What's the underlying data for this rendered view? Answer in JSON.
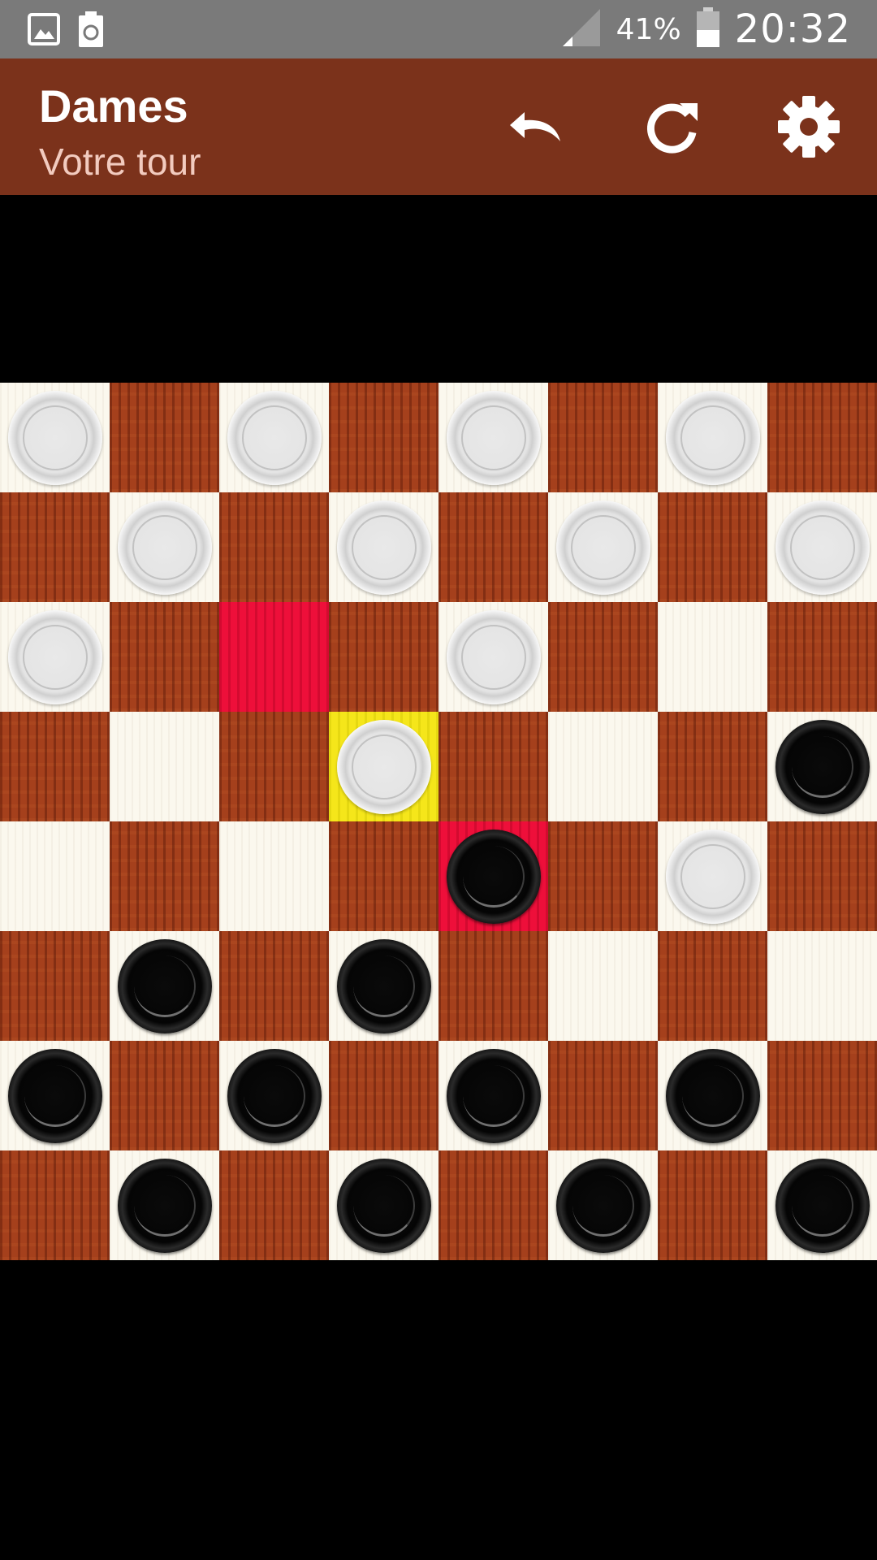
{
  "status_bar": {
    "battery_percent": "41%",
    "time": "20:32",
    "left_icons": [
      "image-icon",
      "recycle-icon"
    ],
    "right_icons": [
      "signal-icon",
      "battery-icon"
    ]
  },
  "app_bar": {
    "title": "Dames",
    "subtitle": "Votre tour",
    "background_color": "#7b321b",
    "actions": [
      "undo-icon",
      "refresh-icon",
      "settings-icon"
    ]
  },
  "board": {
    "rows": 8,
    "cols": 8,
    "light_color": "#fbf8ee",
    "dark_color": "#a5401c",
    "highlight_colors": {
      "red": "#ee0f3a",
      "yellow": "#f5e61a"
    },
    "grid": [
      "W.W.W.W.",
      ".W.W.W.W",
      "W.r.W...",
      "...y...B",
      "....b.W.",
      ".B.B....",
      "B.B.B.B.",
      ".B.B.B.B"
    ],
    "legend": {
      "W": "white piece",
      "B": "black piece",
      "r": "red highlighted empty square",
      "y": "yellow highlighted white piece",
      "b": "red highlighted black piece"
    }
  }
}
